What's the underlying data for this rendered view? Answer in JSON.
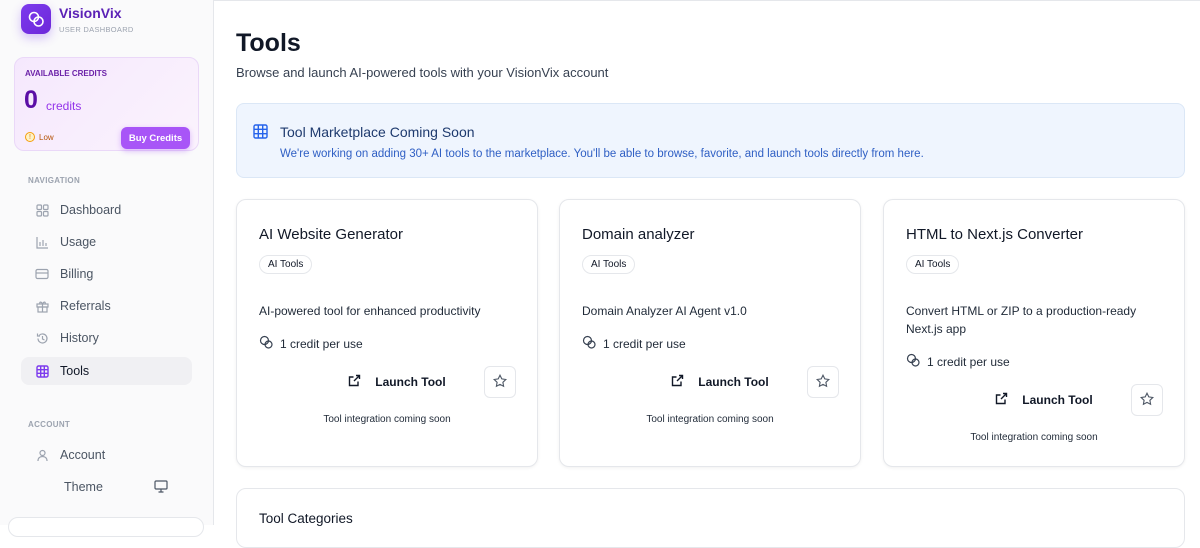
{
  "brand": {
    "name": "VisionVix",
    "subtitle": "USER DASHBOARD"
  },
  "credits": {
    "label": "AVAILABLE CREDITS",
    "amount": "0",
    "unit": "credits",
    "status": "Low",
    "buy_label": "Buy Credits"
  },
  "sidebar": {
    "nav_heading": "NAVIGATION",
    "nav": [
      {
        "label": "Dashboard",
        "icon": "grid-icon"
      },
      {
        "label": "Usage",
        "icon": "bar-chart-icon"
      },
      {
        "label": "Billing",
        "icon": "credit-card-icon"
      },
      {
        "label": "Referrals",
        "icon": "gift-icon"
      },
      {
        "label": "History",
        "icon": "history-icon"
      },
      {
        "label": "Tools",
        "icon": "table-grid-icon",
        "active": true
      }
    ],
    "account_heading": "ACCOUNT",
    "account": {
      "label": "Account"
    },
    "theme": {
      "label": "Theme"
    }
  },
  "page": {
    "title": "Tools",
    "subtitle": "Browse and launch AI-powered tools with your VisionVix account"
  },
  "banner": {
    "title": "Tool Marketplace Coming Soon",
    "text": "We're working on adding 30+ AI tools to the marketplace. You'll be able to browse, favorite, and launch tools directly from here."
  },
  "tools": [
    {
      "title": "AI Website Generator",
      "tag": "AI Tools",
      "desc": "AI-powered tool for enhanced productivity",
      "cost": "1 credit per use",
      "launch": "Launch Tool",
      "note": "Tool integration coming soon"
    },
    {
      "title": "Domain analyzer",
      "tag": "AI Tools",
      "desc": "Domain Analyzer AI Agent v1.0",
      "cost": "1 credit per use",
      "launch": "Launch Tool",
      "note": "Tool integration coming soon"
    },
    {
      "title": "HTML to Next.js Converter",
      "tag": "AI Tools",
      "desc": "Convert HTML or ZIP to a production-ready Next.js app",
      "cost": "1 credit per use",
      "launch": "Launch Tool",
      "note": "Tool integration coming soon"
    }
  ],
  "categories": {
    "title": "Tool Categories"
  }
}
